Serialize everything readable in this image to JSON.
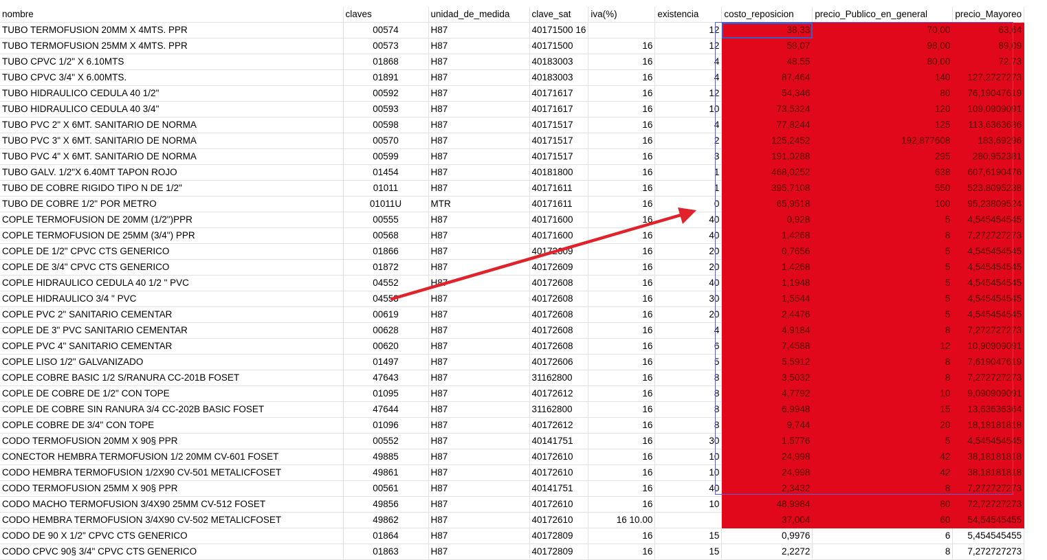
{
  "colors": {
    "highlight": "#e0081a",
    "arrow": "#e0222b",
    "selection": "#5a60d0"
  },
  "headers": [
    "nombre",
    "claves",
    "unidad_de_medida",
    "clave_sat",
    "iva(%)",
    "existencia",
    "costo_reposicion",
    "precio_Publico_en_general",
    "precio_Mayoreo"
  ],
  "rows": [
    [
      "TUBO TERMOFUSION 20MM X 4MTS. PPR",
      "00574",
      "H87",
      "40171500 16",
      "",
      "12",
      "38,33",
      "70,00",
      "63,64"
    ],
    [
      "TUBO TERMOFUSION 25MM X 4MTS. PPR",
      "00573",
      "H87",
      "40171500",
      "16",
      "12",
      "58,07",
      "98,00",
      "89,09"
    ],
    [
      "TUBO CPVC 1/2\" X 6.10MTS",
      "01868",
      "H87",
      "40183003",
      "16",
      "4",
      "48,55",
      "80,00",
      "72,73"
    ],
    [
      "TUBO CPVC 3/4\" X 6.00MTS.",
      "01891",
      "H87",
      "40183003",
      "16",
      "4",
      "87,464",
      "140",
      "127,2727273"
    ],
    [
      "TUBO HIDRAULICO CEDULA 40 1/2\"",
      "00592",
      "H87",
      "40171617",
      "16",
      "12",
      "54,346",
      "80",
      "76,19047619"
    ],
    [
      "TUBO HIDRAULICO CEDULA 40 3/4\"",
      "00593",
      "H87",
      "40171617",
      "16",
      "10",
      "73,5324",
      "120",
      "109,0909091"
    ],
    [
      "TUBO PVC 2\" X 6MT. SANITARIO DE NORMA",
      "00598",
      "H87",
      "40171517",
      "16",
      "4",
      "77,8244",
      "125",
      "113,6363636"
    ],
    [
      "TUBO PVC 3\" X 6MT. SANITARIO DE NORMA",
      "00570",
      "H87",
      "40171517",
      "16",
      "2",
      "125,2452",
      "192,877608",
      "183,69296"
    ],
    [
      "TUBO PVC 4\" X 6MT. SANITARIO DE NORMA",
      "00599",
      "H87",
      "40171517",
      "16",
      "3",
      "191,0288",
      "295",
      "280,952381"
    ],
    [
      "TUBO GALV. 1/2\"X 6.40MT TAPON ROJO",
      "01454",
      "H87",
      "40181800",
      "16",
      "1",
      "468,0252",
      "638",
      "607,6190476"
    ],
    [
      "TUBO DE COBRE RIGIDO TIPO N DE 1/2\"",
      "01011",
      "H87",
      "40171611",
      "16",
      "1",
      "395,7108",
      "550",
      "523,8095238"
    ],
    [
      "TUBO DE COBRE 1/2\" POR METRO",
      "01011U",
      "MTR",
      "40171611",
      "16",
      "0",
      "65,9518",
      "100",
      "95,23809524"
    ],
    [
      "COPLE TERMOFUSION DE 20MM (1/2\")PPR",
      "00555",
      "H87",
      "40171600",
      "16",
      "40",
      "0,928",
      "5",
      "4,545454545"
    ],
    [
      "COPLE TERMOFUSION DE 25MM (3/4\") PPR",
      "00568",
      "H87",
      "40171600",
      "16",
      "40",
      "1,4268",
      "8",
      "7,272727273"
    ],
    [
      "COPLE DE 1/2\" CPVC CTS GENERICO",
      "01866",
      "H87",
      "40172609",
      "16",
      "20",
      "0,7656",
      "5",
      "4,545454545"
    ],
    [
      "COPLE DE 3/4\" CPVC CTS GENERICO",
      "01872",
      "H87",
      "40172609",
      "16",
      "20",
      "1,4268",
      "5",
      "4,545454545"
    ],
    [
      "COPLE HIDRAULICO CEDULA 40 1/2 \" PVC",
      "04552",
      "H87",
      "40172608",
      "16",
      "40",
      "1,1948",
      "5",
      "4,545454545"
    ],
    [
      "COPLE HIDRAULICO 3/4 \" PVC",
      "04553",
      "H87",
      "40172608",
      "16",
      "30",
      "1,5544",
      "5",
      "4,545454545"
    ],
    [
      "COPLE PVC 2\" SANITARIO CEMENTAR",
      "00619",
      "H87",
      "40172608",
      "16",
      "20",
      "2,4476",
      "5",
      "4,545454545"
    ],
    [
      "COPLE DE 3\" PVC SANITARIO CEMENTAR",
      "00628",
      "H87",
      "40172608",
      "16",
      "4",
      "4,9184",
      "8",
      "7,272727273"
    ],
    [
      "COPLE PVC 4\" SANITARIO CEMENTAR",
      "00620",
      "H87",
      "40172608",
      "16",
      "6",
      "7,4588",
      "12",
      "10,90909091"
    ],
    [
      "COPLE LISO 1/2\" GALVANIZADO",
      "01497",
      "H87",
      "40172606",
      "16",
      "5",
      "5,5912",
      "8",
      "7,619047619"
    ],
    [
      "COPLE COBRE BASIC 1/2 S/RANURA CC-201B FOSET",
      "47643",
      "H87",
      "31162800",
      "16",
      "8",
      "3,5032",
      "8",
      "7,272727273"
    ],
    [
      "COPLE DE COBRE DE 1/2\" CON TOPE",
      "01095",
      "H87",
      "40172612",
      "16",
      "8",
      "4,7792",
      "10",
      "9,090909091"
    ],
    [
      "COPLE DE COBRE SIN RANURA 3/4 CC-202B BASIC FOSET",
      "47644",
      "H87",
      "31162800",
      "16",
      "8",
      "6,9948",
      "15",
      "13,63636364"
    ],
    [
      "COPLE COBRE DE 3/4\" CON TOPE",
      "01096",
      "H87",
      "40172612",
      "16",
      "8",
      "9,744",
      "20",
      "18,18181818"
    ],
    [
      "CODO TERMOFUSION 20MM X 90§ PPR",
      "00552",
      "H87",
      "40141751",
      "16",
      "30",
      "1,5776",
      "5",
      "4,545454545"
    ],
    [
      "CONECTOR HEMBRA TERMOFUSION 1/2 20MM CV-601 FOSET",
      "49885",
      "H87",
      "40172610",
      "16",
      "10",
      "24,998",
      "42",
      "38,18181818"
    ],
    [
      "CODO HEMBRA TERMOFUSION 1/2X90 CV-501 METALICFOSET",
      "49861",
      "H87",
      "40172610",
      "16",
      "10",
      "24,998",
      "42",
      "38,18181818"
    ],
    [
      "CODO TERMOFUSION 25MM X 90§ PPR",
      "00561",
      "H87",
      "40141751",
      "16",
      "40",
      "2,3432",
      "8",
      "7,272727273"
    ],
    [
      "CODO MACHO TERMOFUSION 3/4X90 25MM CV-512 FOSET",
      "49856",
      "H87",
      "40172610",
      "16",
      "10",
      "48,9984",
      "80",
      "72,72727273"
    ],
    [
      "CODO HEMBRA TERMOFUSION 3/4X90 CV-502 METALICFOSET",
      "49862",
      "H87",
      "40172610",
      "16 10.00",
      "",
      "37,004",
      "60",
      "54,54545455"
    ],
    [
      "CODO DE 90 X 1/2\" CPVC CTS GENERICO",
      "01864",
      "H87",
      "40172809",
      "16",
      "15",
      "0,9976",
      "6",
      "5,454545455"
    ],
    [
      "CODO CPVC 90§ 3/4\" CPVC CTS GENERICO",
      "01863",
      "H87",
      "40172809",
      "16",
      "15",
      "2,2272",
      "8",
      "7,272727273"
    ]
  ]
}
